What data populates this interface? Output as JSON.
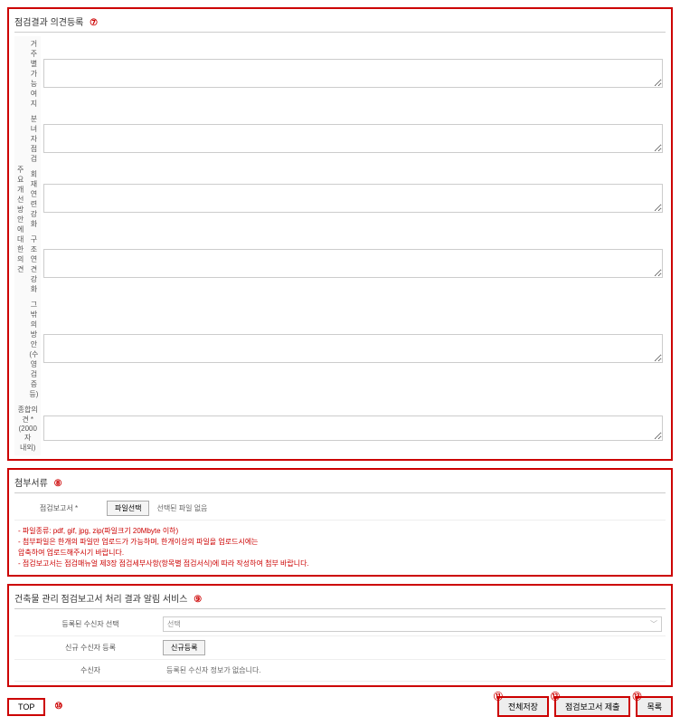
{
  "section7": {
    "title": "점검결과 의견등록",
    "badge": "⑦",
    "groupLabel": "주요 개선\n방안에\n대한 의견",
    "rows": [
      {
        "label": "거주별\n가능여지"
      },
      {
        "label": "분녀자\n점검"
      },
      {
        "label": "회재연련\n강화"
      },
      {
        "label": "구조연견\n강화"
      },
      {
        "label": "그 밖의 방안\n(수영 검증 등)"
      }
    ],
    "bottom": {
      "label": "종합의견 *\n(2000자\n내외)"
    }
  },
  "section8": {
    "title": "첨부서류",
    "badge": "⑧",
    "fileLabel": "점검보고서 *",
    "fileBtn": "파일선택",
    "fileStatus": "선택된 파일 없음",
    "notes": [
      "- 파일종류: pdf, gif, jpg, zip(파일크기 20Mbyte 이하)",
      "- 첨부파일은 한개의 파일만 업로드가 가능하며, 한개이상의 파일을 업로드시에는",
      "  압축하여 업로드해주시기 바랍니다.",
      "- 점검보고서는 점검매뉴얼 제3장 점검세부사항(항목별 점검서식)에 따라 작성하여 첨부 바랍니다."
    ]
  },
  "section9": {
    "title": "건축물 관리 점검보고서 처리 결과 알림 서비스",
    "badge": "⑨",
    "rows": {
      "row1Label": "등록된 수신자 선택",
      "row1Value": "선택",
      "row2Label": "신규 수신자 등록",
      "row2Btn": "신규등록",
      "row3Label": "수신자",
      "row3Value": "등록된 수신자 정보가 없습니다."
    }
  },
  "footer": {
    "top": "TOP",
    "topBadge": "⑩",
    "save": "전체저장",
    "saveBadge": "⑪",
    "submit": "점검보고서 제출",
    "submitBadge": "⑫",
    "list": "목록",
    "listBadge": "⑬"
  }
}
